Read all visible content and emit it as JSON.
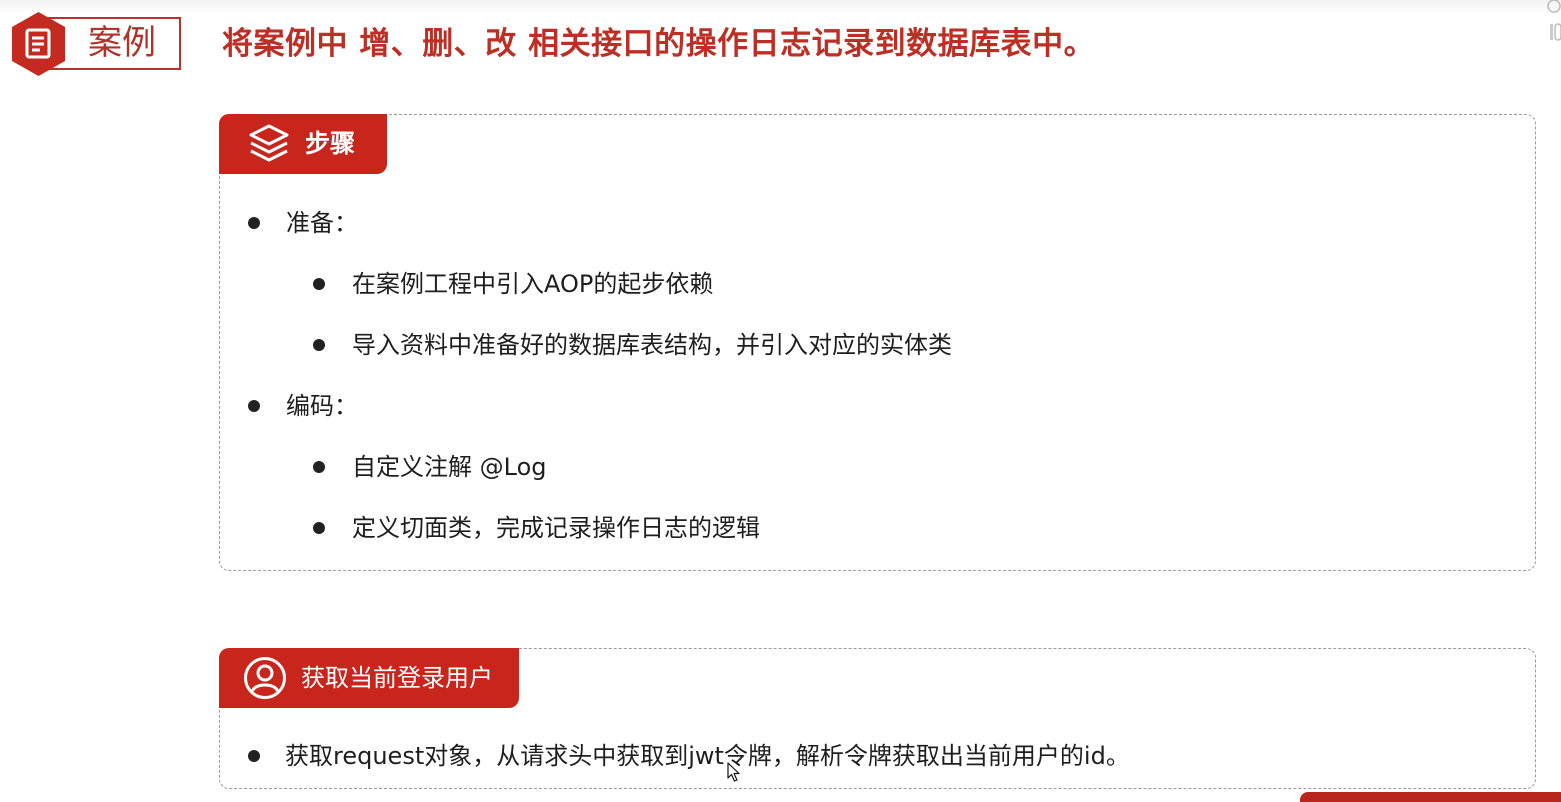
{
  "header": {
    "badge_label": "案例",
    "title": "将案例中 增、删、改 相关接口的操作日志记录到数据库表中。"
  },
  "steps_panel": {
    "tab_label": "步骤",
    "items": [
      {
        "text": "准备：",
        "level": 1
      },
      {
        "text": "在案例工程中引入AOP的起步依赖",
        "level": 2
      },
      {
        "text": "导入资料中准备好的数据库表结构，并引入对应的实体类",
        "level": 2
      },
      {
        "text": "编码：",
        "level": 1
      },
      {
        "text": "自定义注解 @Log",
        "level": 2
      },
      {
        "text": "定义切面类，完成记录操作日志的逻辑",
        "level": 2
      }
    ]
  },
  "user_panel": {
    "tab_label": "获取当前登录用户",
    "items": [
      {
        "text": "获取request对象，从请求头中获取到jwt令牌，解析令牌获取出当前用户的id。",
        "level": 1
      }
    ]
  },
  "colors": {
    "accent": "#c8261c",
    "title_red": "#bd2e24",
    "text": "#1e1e1e"
  },
  "icons": {
    "badge": "document-icon",
    "steps": "layers-icon",
    "user": "user-icon",
    "cursor": "pointer-cursor-icon"
  }
}
